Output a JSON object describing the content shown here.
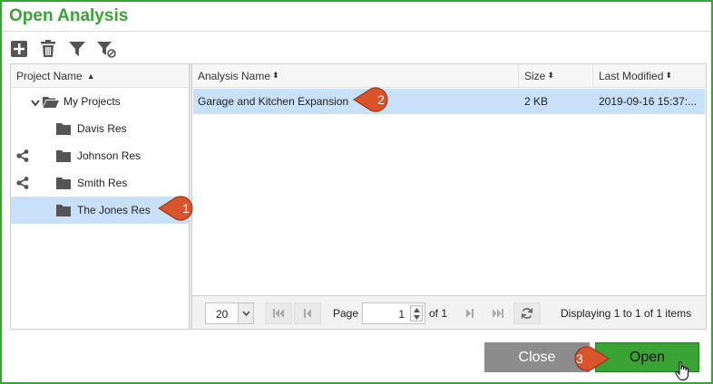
{
  "dialog": {
    "title": "Open Analysis"
  },
  "toolbar": {
    "icons": [
      "add-icon",
      "trash-icon",
      "filter-icon",
      "clear-filter-icon"
    ]
  },
  "tree": {
    "header": "Project Name",
    "root": "My Projects",
    "items": [
      {
        "label": "Davis Res",
        "shared": false,
        "selected": false
      },
      {
        "label": "Johnson Res",
        "shared": true,
        "selected": false
      },
      {
        "label": "Smith Res",
        "shared": true,
        "selected": false
      },
      {
        "label": "The Jones Res",
        "shared": false,
        "selected": true
      }
    ]
  },
  "grid": {
    "columns": [
      "Analysis Name",
      "Size",
      "Last Modified"
    ],
    "rows": [
      {
        "name": "Garage and Kitchen Expansion",
        "size": "2 KB",
        "modified": "2019-09-16 15:37:..."
      }
    ]
  },
  "pager": {
    "page_size": "20",
    "page_label": "Page",
    "page": "1",
    "of_label": "of 1",
    "display": "Displaying 1 to 1 of 1 items"
  },
  "buttons": {
    "close": "Close",
    "open": "Open"
  },
  "callouts": [
    "1",
    "2",
    "3"
  ],
  "colors": {
    "accent": "#3aa335",
    "callout": "#d9542b",
    "selection": "#c8e0f8",
    "close_button": "#8c8c8c"
  }
}
